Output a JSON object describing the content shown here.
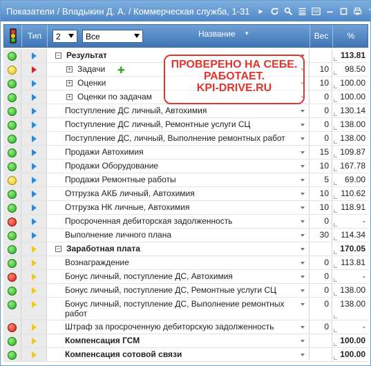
{
  "title": "Показатели / Владыкин Д. А. / Коммерческая служба, 1-31",
  "header": {
    "type_label": "Тип",
    "level_value": "2",
    "filter_value": "Все",
    "name_label": "Название",
    "weight_label": "Вес",
    "percent_label": "%"
  },
  "stamp": [
    "ПРОВЕРЕНО НА СЕБЕ.",
    "РАБОТАЕТ.",
    "KPI-DRIVE.RU"
  ],
  "colors": {
    "titlebar": "#4f86c6",
    "header": "#3f76b6",
    "stamp": "#e0342e"
  },
  "rows": [
    {
      "status": "green",
      "type": "blue",
      "name": "Результат",
      "weight": "",
      "percent": "113.81",
      "bold": true,
      "level": 0,
      "expander": "⊟"
    },
    {
      "status": "yellow",
      "type": "red",
      "name": "Задачи",
      "weight": "10",
      "percent": "98.50",
      "bold": false,
      "level": 1,
      "expander": "⊞",
      "plus": true
    },
    {
      "status": "green",
      "type": "blue",
      "name": "Оценки",
      "weight": "10",
      "percent": "100.00",
      "bold": false,
      "level": 1,
      "expander": "⊞"
    },
    {
      "status": "green",
      "type": "blue",
      "name": "Оценки по задачам",
      "weight": "0",
      "percent": "100.00",
      "bold": false,
      "level": 1,
      "expander": "⊞"
    },
    {
      "status": "green",
      "type": "blue",
      "name": "Поступление ДС личный, Автохимия",
      "weight": "0",
      "percent": "130.14",
      "bold": false,
      "level": 2
    },
    {
      "status": "green",
      "type": "blue",
      "name": "Поступление ДС личный, Ремонтные услуги СЦ",
      "weight": "0",
      "percent": "138.00",
      "bold": false,
      "level": 2
    },
    {
      "status": "green",
      "type": "blue",
      "name": "Поступление ДС, личный, Выполнение ремонтных работ",
      "weight": "0",
      "percent": "138.00",
      "bold": false,
      "level": 2
    },
    {
      "status": "green",
      "type": "blue",
      "name": "Продажи Автохимия",
      "weight": "15",
      "percent": "109.87",
      "bold": false,
      "level": 2
    },
    {
      "status": "green",
      "type": "blue",
      "name": "Продажи Оборудование",
      "weight": "10",
      "percent": "167.78",
      "bold": false,
      "level": 2
    },
    {
      "status": "yellow",
      "type": "blue",
      "name": "Продажи Ремонтные работы",
      "weight": "5",
      "percent": "69.00",
      "bold": false,
      "level": 2
    },
    {
      "status": "green",
      "type": "blue",
      "name": "Отгрузка АКБ личный, Автохимия",
      "weight": "10",
      "percent": "110.62",
      "bold": false,
      "level": 2
    },
    {
      "status": "green",
      "type": "blue",
      "name": "Отгрузка НК личные, Автохимия",
      "weight": "10",
      "percent": "118.91",
      "bold": false,
      "level": 2
    },
    {
      "status": "red",
      "type": "blue",
      "name": "Просроченная дебиторская задолженность",
      "weight": "0",
      "percent": "-",
      "bold": false,
      "level": 2
    },
    {
      "status": "green",
      "type": "blue",
      "name": "Выполнение личного плана",
      "weight": "30",
      "percent": "114.34",
      "bold": false,
      "level": 2
    },
    {
      "status": "green",
      "type": "yellow",
      "name": "Заработная плата",
      "weight": "",
      "percent": "170.05",
      "bold": true,
      "level": 0,
      "expander": "⊟"
    },
    {
      "status": "green",
      "type": "yellow",
      "name": "Вознаграждение",
      "weight": "0",
      "percent": "113.81",
      "bold": false,
      "level": 2
    },
    {
      "status": "red",
      "type": "yellow",
      "name": "Бонус личный, поступление ДС, Автохимия",
      "weight": "0",
      "percent": "-",
      "bold": false,
      "level": 2
    },
    {
      "status": "green",
      "type": "yellow",
      "name": "Бонус личный, поступление ДС, Ремонтные услуги СЦ",
      "weight": "0",
      "percent": "138.00",
      "bold": false,
      "level": 2
    },
    {
      "status": "green",
      "type": "yellow",
      "name": "Бонус личный, поступление ДС, Выполнение ремонтных работ",
      "weight": "0",
      "percent": "138.00",
      "bold": false,
      "level": 2,
      "tall": true
    },
    {
      "status": "red",
      "type": "yellow",
      "name": "Штраф за просроченную дебиторскую задолженность",
      "weight": "0",
      "percent": "-",
      "bold": false,
      "level": 2
    },
    {
      "status": "green",
      "type": "yellow",
      "name": "Компенсация ГСМ",
      "weight": "",
      "percent": "100.00",
      "bold": true,
      "level": 2
    },
    {
      "status": "green",
      "type": "yellow",
      "name": "Компенсация сотовой связи",
      "weight": "",
      "percent": "100.00",
      "bold": true,
      "level": 2
    }
  ]
}
